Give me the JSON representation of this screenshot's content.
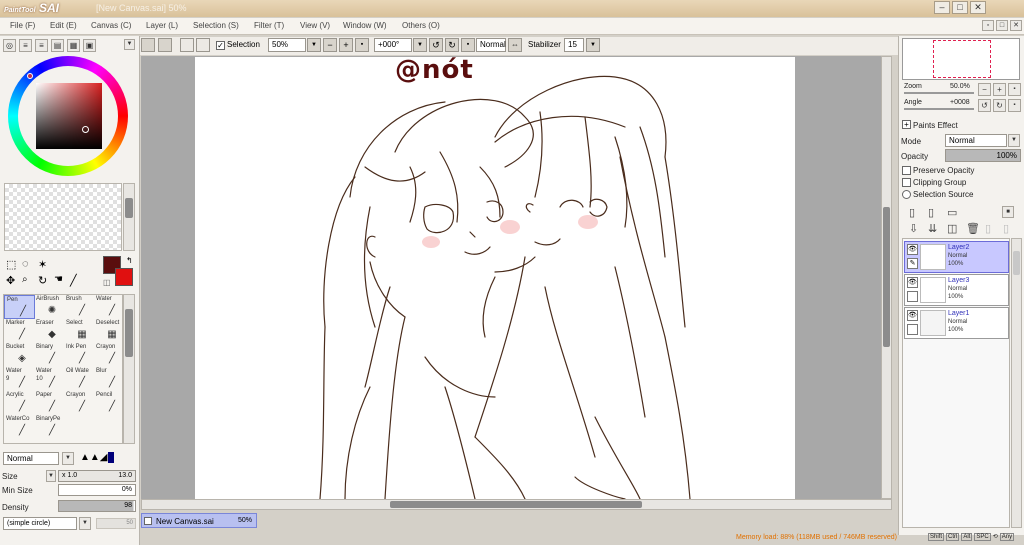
{
  "titlebar": {
    "app_name": "SAI",
    "logo_text": "PaintTool",
    "title": "[New Canvas.sai] 50%"
  },
  "menu": [
    "File (F)",
    "Edit (E)",
    "Canvas (C)",
    "Layer (L)",
    "Selection (S)",
    "Filter (T)",
    "View (V)",
    "Window (W)",
    "Others (O)"
  ],
  "toolbar": {
    "selection_label": "Selection",
    "zoom_value": "50%",
    "angle_value": "+000°",
    "blend_mode": "Normal",
    "stabilizer_label": "Stabilizer",
    "stabilizer_value": "15"
  },
  "color": {
    "primary": "#5a0e0e",
    "secondary": "#e01010",
    "wheel_selected": "#4a0a0a"
  },
  "tools_top": [
    {
      "name": "select-rect-icon",
      "glyph": "⬚"
    },
    {
      "name": "lasso-icon",
      "glyph": "◌"
    },
    {
      "name": "magic-wand-icon",
      "glyph": "✶"
    },
    {
      "name": "move-icon",
      "glyph": "✥"
    },
    {
      "name": "zoom-icon",
      "glyph": "🔍"
    },
    {
      "name": "rotate-icon",
      "glyph": "↻"
    },
    {
      "name": "hand-icon",
      "glyph": "✋"
    },
    {
      "name": "eyedropper-icon",
      "glyph": "╱"
    }
  ],
  "brush_tools": [
    {
      "label": "Pen",
      "icon": "pen-icon",
      "glyph": "╱",
      "selected": true
    },
    {
      "label": "AirBrush",
      "icon": "airbrush-icon",
      "glyph": "✺"
    },
    {
      "label": "Brush",
      "icon": "brush-icon",
      "glyph": "╱"
    },
    {
      "label": "Water",
      "icon": "water-icon",
      "glyph": "╱"
    },
    {
      "label": "Marker",
      "icon": "marker-icon",
      "glyph": "╱"
    },
    {
      "label": "Eraser",
      "icon": "eraser-icon",
      "glyph": "◆"
    },
    {
      "label": "Select",
      "icon": "select-icon",
      "glyph": "▦"
    },
    {
      "label": "Deselect",
      "icon": "deselect-icon",
      "glyph": "▦"
    },
    {
      "label": "Bucket",
      "icon": "bucket-icon",
      "glyph": "◈"
    },
    {
      "label": "Binary",
      "icon": "binary-icon",
      "glyph": "╱"
    },
    {
      "label": "Ink Pen",
      "icon": "ink-pen-icon",
      "glyph": "╱"
    },
    {
      "label": "Crayon",
      "icon": "crayon-icon",
      "glyph": "╱"
    },
    {
      "label": "Water",
      "sub": "9",
      "icon": "water-icon",
      "glyph": "╱"
    },
    {
      "label": "Water",
      "sub": "10",
      "icon": "water-icon",
      "glyph": "╱"
    },
    {
      "label": "Oil Wate",
      "icon": "oil-water-icon",
      "glyph": "╱"
    },
    {
      "label": "Blur",
      "icon": "blur-icon",
      "glyph": "╱"
    },
    {
      "label": "Acrylic",
      "icon": "acrylic-icon",
      "glyph": "╱"
    },
    {
      "label": "Paper",
      "icon": "paper-icon",
      "glyph": "╱"
    },
    {
      "label": "Crayon",
      "icon": "crayon-icon",
      "glyph": "╱"
    },
    {
      "label": "Pencil",
      "icon": "pencil-icon",
      "glyph": "╱"
    },
    {
      "label": "WaterCo",
      "icon": "watercolor-icon",
      "glyph": "╱"
    },
    {
      "label": "BinaryPe",
      "icon": "binary-pen-icon",
      "glyph": "╱"
    }
  ],
  "brush_settings": {
    "blend_mode": "Normal",
    "size_label": "Size",
    "size_multiplier": "x 1.0",
    "size_value": "13.0",
    "min_size_label": "Min Size",
    "min_size_value": "0%",
    "density_label": "Density",
    "density_value": "98",
    "shape": "(simple circle)",
    "shape_value": "50"
  },
  "canvas": {
    "watermark": "@nót"
  },
  "document_tab": {
    "name": "New Canvas.sai",
    "zoom": "50%"
  },
  "navigator": {
    "zoom_label": "Zoom",
    "zoom_value": "50.0%",
    "angle_label": "Angle",
    "angle_value": "+0008"
  },
  "layer_props": {
    "paints_effect": "Paints Effect",
    "mode_label": "Mode",
    "mode_value": "Normal",
    "opacity_label": "Opacity",
    "opacity_value": "100%",
    "preserve_opacity": "Preserve Opacity",
    "clipping_group": "Clipping Group",
    "selection_source": "Selection Source"
  },
  "layers": [
    {
      "name": "Layer2",
      "mode": "Normal",
      "opacity": "100%",
      "active": true
    },
    {
      "name": "Layer3",
      "mode": "Normal",
      "opacity": "100%",
      "active": false
    },
    {
      "name": "Layer1",
      "mode": "Normal",
      "opacity": "100%",
      "active": false
    }
  ],
  "status": {
    "memory": "Memory load: 88% (118MB used / 746MB reserved)",
    "keys": [
      "Shift",
      "Ctrl",
      "Alt",
      "SPC",
      "Any"
    ]
  }
}
